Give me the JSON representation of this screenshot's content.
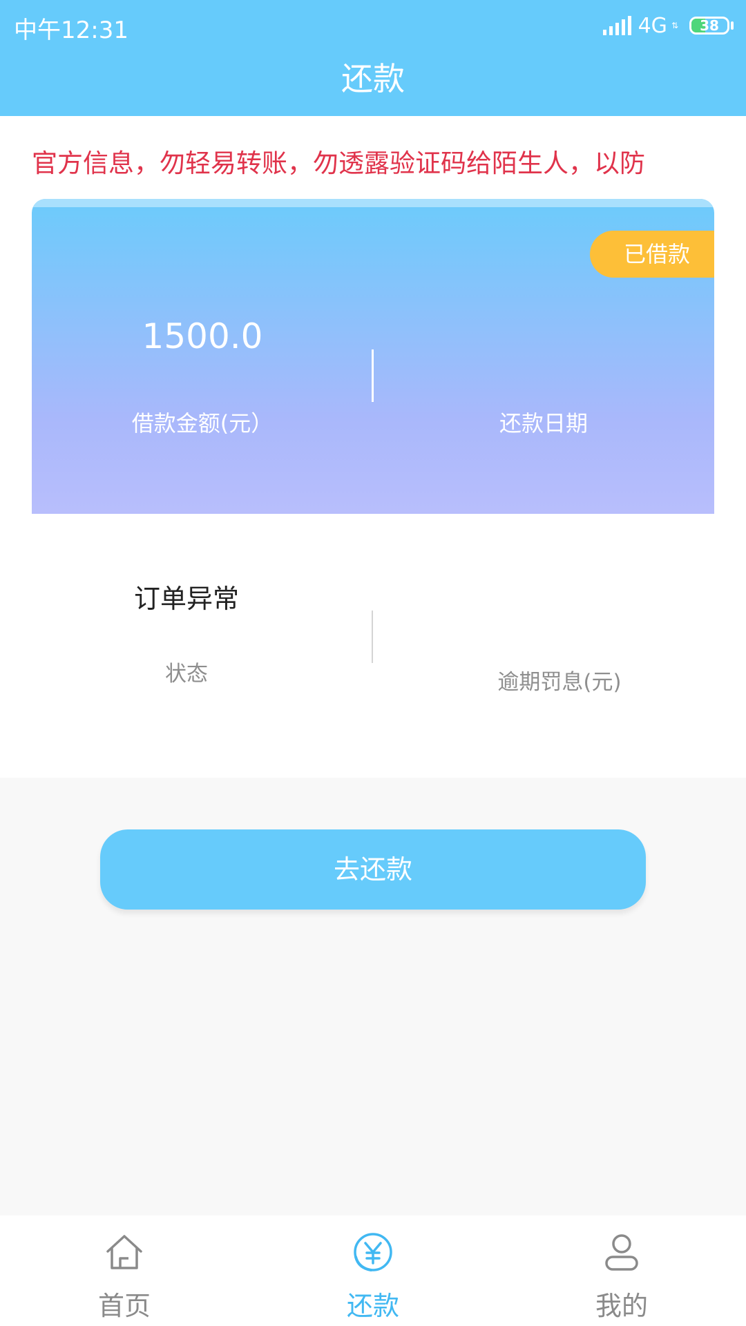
{
  "status_bar": {
    "time": "中午12:31",
    "network": "4G",
    "battery": "38",
    "battery_percent": 38
  },
  "header": {
    "title": "还款"
  },
  "notice": {
    "text": "官方信息，勿轻易转账，勿透露验证码给陌生人，以防"
  },
  "loan_card": {
    "badge": "已借款",
    "amount": "1500.0",
    "amount_label": "借款金额(元）",
    "due_date_label": "还款日期"
  },
  "loan_info": {
    "status_value": "订单异常",
    "status_label": "状态",
    "penalty_label": "逾期罚息(元)"
  },
  "actions": {
    "repay_label": "去还款"
  },
  "bottom_nav": {
    "items": [
      {
        "label": "首页",
        "icon": "home-icon"
      },
      {
        "label": "还款",
        "icon": "yuan-circle-icon"
      },
      {
        "label": "我的",
        "icon": "user-icon"
      }
    ],
    "active_index": 1
  },
  "colors": {
    "primary": "#66cbfb",
    "badge": "#fdbf38",
    "notice": "#e0334b",
    "nav_active": "#41b8f2",
    "nav_inactive": "#8a8a8a"
  }
}
